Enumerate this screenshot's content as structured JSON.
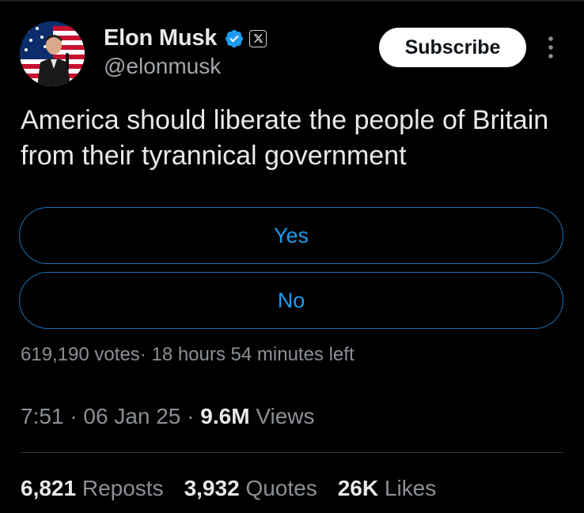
{
  "author": {
    "display_name": "Elon Musk",
    "handle": "@elonmusk",
    "verified_icon": "verified-badge-icon",
    "affiliation_icon": "x-logo-icon"
  },
  "subscribe_label": "Subscribe",
  "tweet": {
    "text": "America should liberate the people of Britain from their tyrannical government"
  },
  "poll": {
    "options": [
      "Yes",
      "No"
    ],
    "votes": "619,190 votes",
    "separator": "·",
    "time_left": "18 hours 54 minutes left"
  },
  "meta": {
    "time": "7:51",
    "date": "06 Jan 25",
    "views_count": "9.6M",
    "views_label": "Views"
  },
  "stats": {
    "reposts_count": "6,821",
    "reposts_label": "Reposts",
    "quotes_count": "3,932",
    "quotes_label": "Quotes",
    "likes_count": "26K",
    "likes_label": "Likes"
  },
  "colors": {
    "background": "#000000",
    "accent": "#1d9bf0",
    "text": "#e7e9ea",
    "muted": "#8b9096"
  }
}
